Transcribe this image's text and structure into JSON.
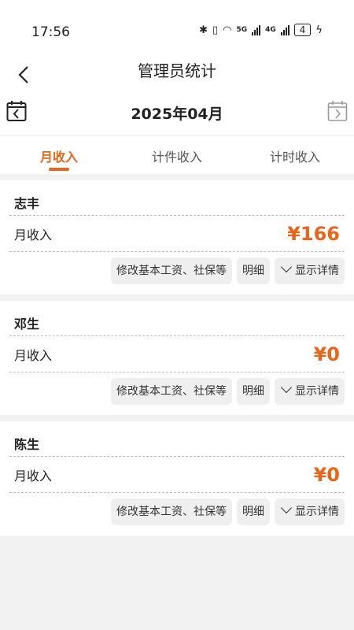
{
  "status": {
    "time": "17:56",
    "net1": "5G",
    "net2": "4G",
    "battery": "4"
  },
  "header": {
    "title": "管理员统计"
  },
  "month": "2025年04月",
  "tabs": [
    "月收入",
    "计件收入",
    "计时收入"
  ],
  "active_tab": 0,
  "accent": "#e8651a",
  "employees": [
    {
      "name": "志丰",
      "label": "月收入",
      "amount": "¥166",
      "btn_edit": "修改基本工资、社保等",
      "btn_detail": "明细",
      "btn_show": "显示详情"
    },
    {
      "name": "邓生",
      "label": "月收入",
      "amount": "¥0",
      "btn_edit": "修改基本工资、社保等",
      "btn_detail": "明细",
      "btn_show": "显示详情"
    },
    {
      "name": "陈生",
      "label": "月收入",
      "amount": "¥0",
      "btn_edit": "修改基本工资、社保等",
      "btn_detail": "明细",
      "btn_show": "显示详情"
    }
  ]
}
